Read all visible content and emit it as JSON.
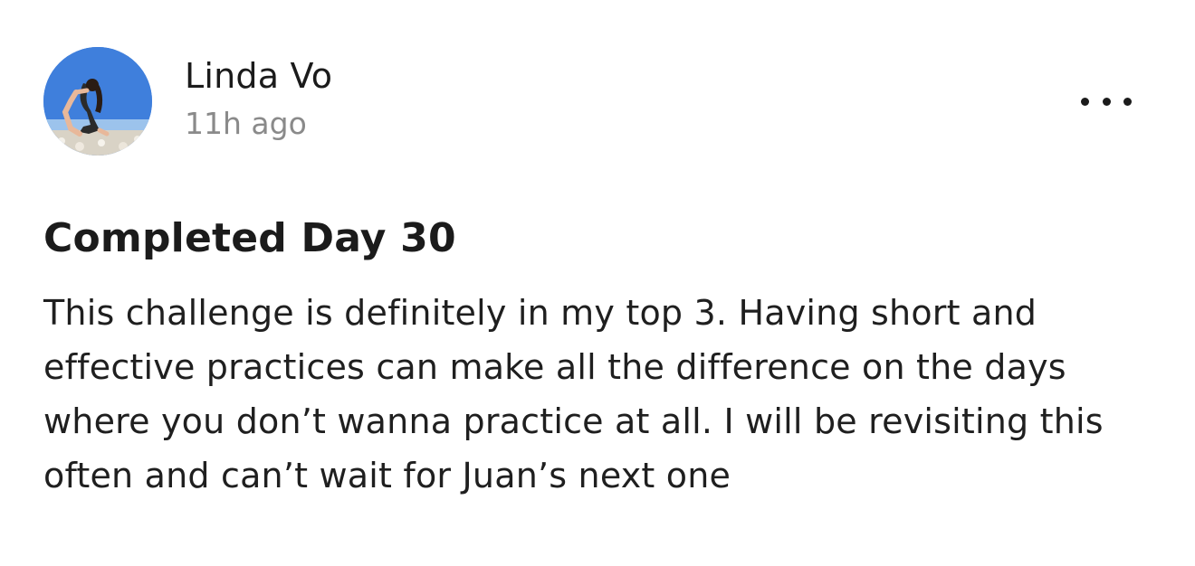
{
  "post": {
    "author": {
      "name": "Linda Vo",
      "avatar_icon": "user-avatar-photo"
    },
    "timestamp": "11h ago",
    "more_icon": "more-horizontal-icon",
    "title": "Completed Day 30",
    "body": "This challenge is definitely in my top 3. Having short and effective practices can make all the difference on the days where you don’t wanna practice at all. I will be revisiting this often and can’t wait for Juan’s next one"
  }
}
